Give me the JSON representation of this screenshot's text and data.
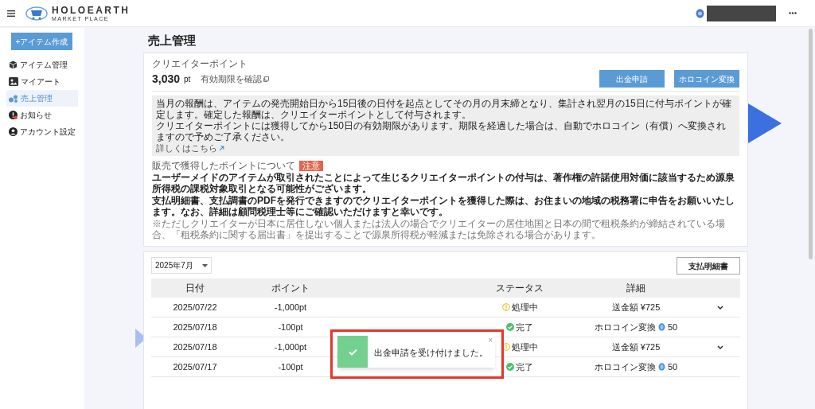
{
  "header": {
    "logo_text": "HOLOEARTH",
    "logo_subtext": "MARKET PLACE"
  },
  "sidebar": {
    "create_button": "+アイテム作成",
    "items": [
      {
        "label": "アイテム管理",
        "selected": false
      },
      {
        "label": "マイアート",
        "selected": false
      },
      {
        "label": "売上管理",
        "selected": true
      },
      {
        "label": "お知らせ",
        "selected": false
      },
      {
        "label": "アカウント設定",
        "selected": false
      }
    ]
  },
  "page_title": "売上管理",
  "points_card": {
    "label": "クリエイターポイント",
    "amount": "3,030",
    "unit": "pt",
    "expiry_link": "有効期限を確認",
    "buttons": [
      "出金申請",
      "ホロコイン変換"
    ],
    "info": [
      "当月の報酬は、アイテムの発売開始日から15日後の日付を起点としてその月の月末締となり、集計され翌月の15日に付与ポイントが確定します。確定した報酬は、クリエイターポイントとして付与されます。",
      "クリエイターポイントには獲得してから150日の有効期限があります。期限を経過した場合は、自動でホロコイン（有償）へ変換されますので予めご了承ください。"
    ],
    "more_link": "詳しくはこちら",
    "notice_title": "販売で獲得したポイントについて",
    "notice_badge": "注意",
    "notice_lines": [
      "ユーザーメイドのアイテムが取引されたことによって生じるクリエイターポイントの付与は、著作権の許諾使用対価に該当するため源泉所得税の課税対象取引となる可能性がございます。",
      "支払明細書、支払調書のPDFを発行できますのでクリエイターポイントを獲得した際は、お住まいの地域の税務署に申告をお願いいたします。なお、詳細は顧問税理士等にご確認いただけますと幸いです。"
    ],
    "footnote": "※ただしクリエイターが日本に居住しない個人または法人の場合でクリエイターの居住地国と日本の間で租税条約が締結されている場合、「租税条約に関する届出書」を提出することで源泉所得税が軽減または免除される場合があります。"
  },
  "history": {
    "month_select": "2025年7月",
    "statement_button": "支払明細書",
    "columns": [
      "日付",
      "ポイント",
      "ステータス",
      "詳細"
    ],
    "rows": [
      {
        "date": "2025/07/22",
        "points": "-1,000pt",
        "kind": "pending",
        "status": "処理中",
        "detail": "送金額 ¥725",
        "expandable": true
      },
      {
        "date": "2025/07/18",
        "points": "-100pt",
        "kind": "done",
        "status": "完了",
        "detail": "ホロコイン変換",
        "coin": "50",
        "expandable": false
      },
      {
        "date": "2025/07/18",
        "points": "-1,000pt",
        "kind": "pending",
        "status": "処理中",
        "detail": "送金額 ¥725",
        "expandable": true
      },
      {
        "date": "2025/07/17",
        "points": "-100pt",
        "kind": "done",
        "status": "完了",
        "detail": "ホロコイン変換",
        "coin": "50",
        "expandable": false
      }
    ]
  },
  "toast": {
    "message": "出金申請を受け付けました。",
    "close": "×"
  }
}
